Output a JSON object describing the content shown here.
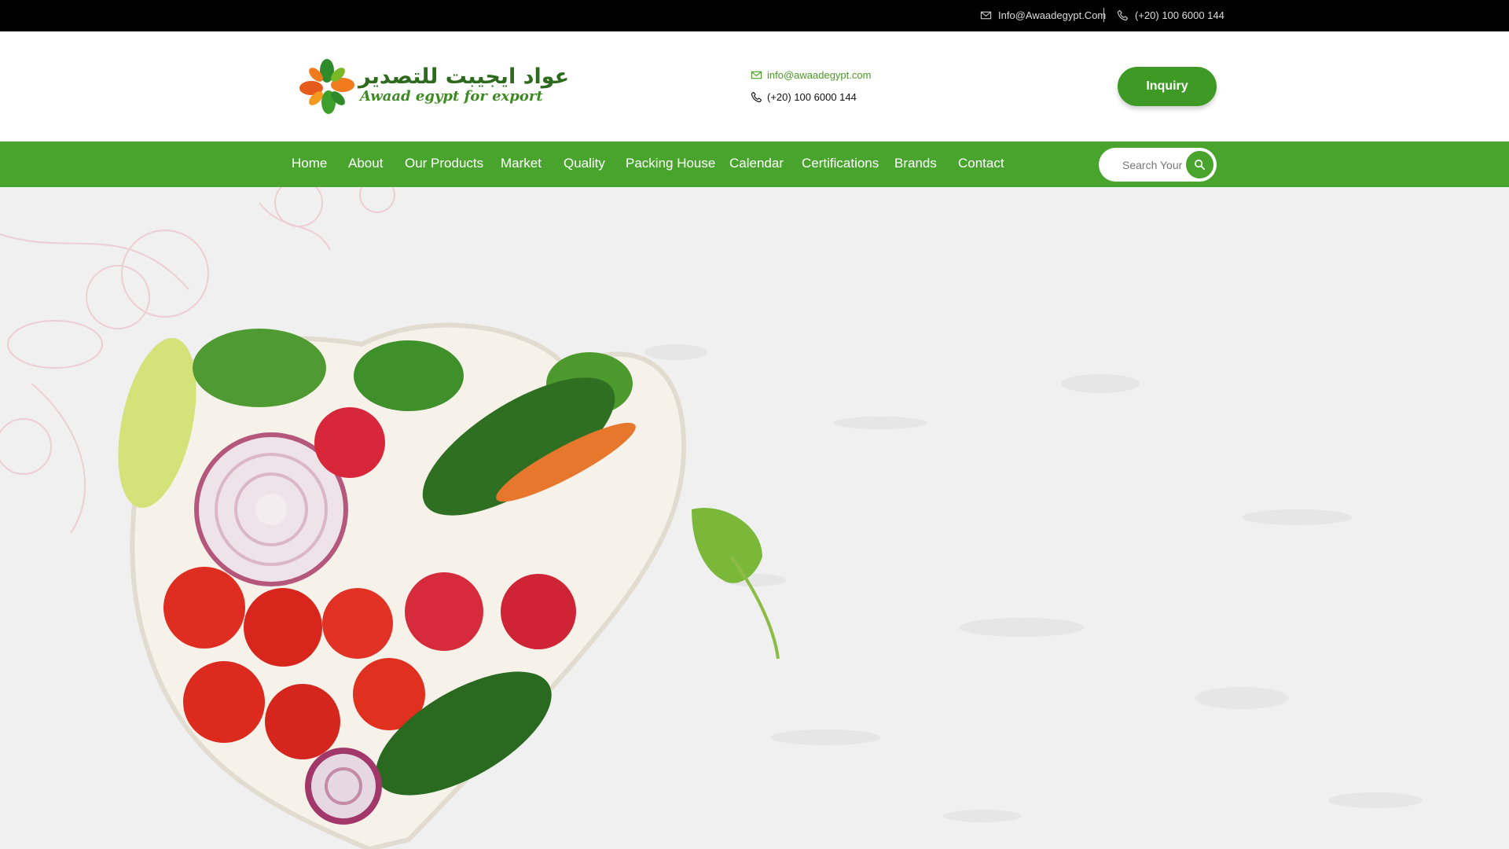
{
  "topbar": {
    "email": "Info@Awaadegypt.Com",
    "phone": "(+20) 100 6000 144"
  },
  "header": {
    "logo": {
      "arabic": "عواد ايجيبت للتصدير",
      "english": "Awaad egypt for export"
    },
    "contact_email": "info@awaadegypt.com",
    "contact_phone": "(+20) 100 6000 144",
    "inquiry_label": "Inquiry"
  },
  "nav": {
    "items": [
      "Home",
      "About",
      "Our Products",
      "Market",
      "Quality",
      "Packing House",
      "Calendar",
      "Certifications",
      "Brands",
      "Contact"
    ],
    "search_placeholder": "Search Your"
  },
  "colors": {
    "brand_green": "#48a42d",
    "topbar": "#000000",
    "accent_orange": "#f07b1e"
  }
}
